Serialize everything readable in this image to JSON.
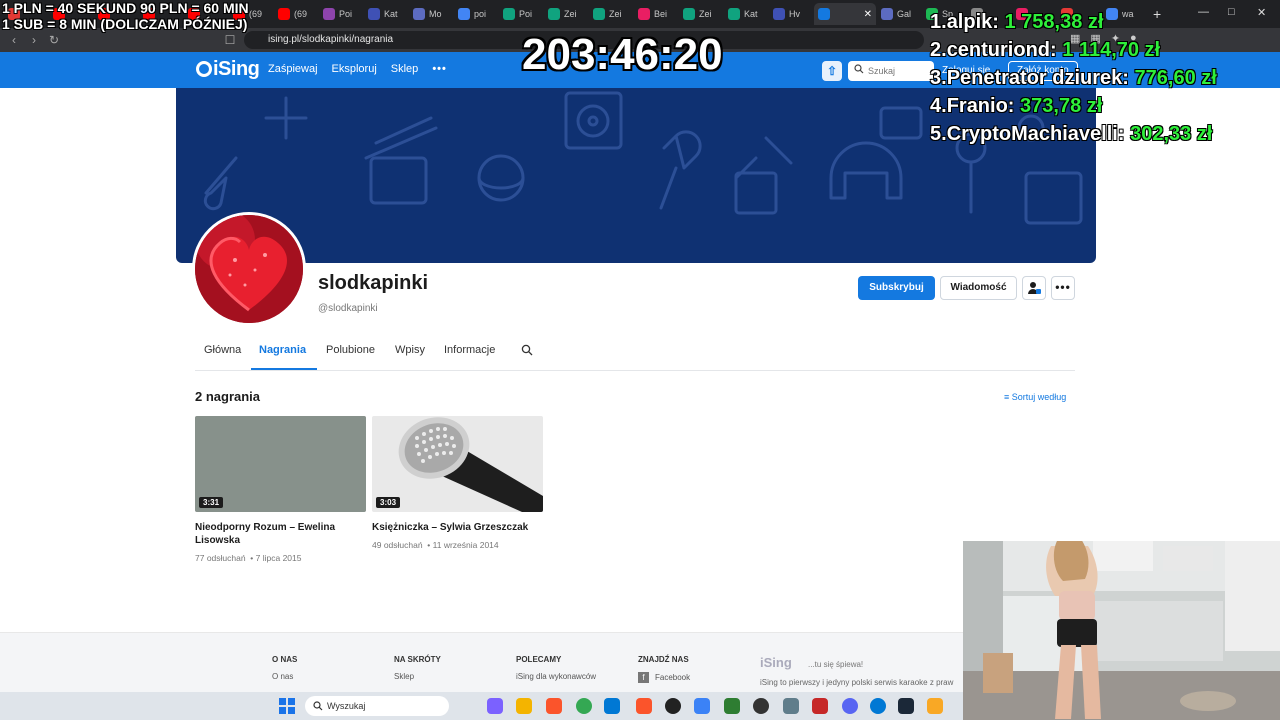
{
  "browser": {
    "tabs": [
      {
        "label": "",
        "color": "#e53935"
      },
      {
        "label": "",
        "color": "#ff0000"
      },
      {
        "label": "",
        "color": "#ff0000"
      },
      {
        "label": "",
        "color": "#ff0000"
      },
      {
        "label": "",
        "color": "#ff0000"
      },
      {
        "label": "(69",
        "color": "#ff0000"
      },
      {
        "label": "(69",
        "color": "#ff0000"
      },
      {
        "label": "Poi",
        "color": "#8e44ad"
      },
      {
        "label": "Kat",
        "color": "#3f51b5"
      },
      {
        "label": "Mo",
        "color": "#5c6bc0"
      },
      {
        "label": "poi",
        "color": "#4285f4"
      },
      {
        "label": "Poi",
        "color": "#10a37f"
      },
      {
        "label": "Zei",
        "color": "#10a37f"
      },
      {
        "label": "Zei",
        "color": "#10a37f"
      },
      {
        "label": "Bei",
        "color": "#e91e63"
      },
      {
        "label": "Zei",
        "color": "#10a37f"
      },
      {
        "label": "Kat",
        "color": "#10a37f"
      },
      {
        "label": "Hv",
        "color": "#3f51b5"
      },
      {
        "label": "",
        "color": "#1479e0",
        "active": true
      },
      {
        "label": "Gal",
        "color": "#5c6bc0"
      },
      {
        "label": "Sp",
        "color": "#1db954"
      },
      {
        "label": "",
        "color": "#888888"
      },
      {
        "label": "",
        "color": "#e91e63"
      },
      {
        "label": "",
        "color": "#e53935"
      },
      {
        "label": "wa",
        "color": "#4285f4"
      }
    ],
    "url": "ising.pl/slodkapinki/nagrania"
  },
  "header": {
    "logo": "iSing",
    "nav": [
      "Zaśpiewaj",
      "Eksploruj",
      "Sklep"
    ],
    "search_placeholder": "Szukaj",
    "login": "Zaloguj się",
    "register": "Załóż konto"
  },
  "profile": {
    "username": "slodkapinki",
    "handle": "@slodkapinki",
    "subscribe": "Subskrybuj",
    "message": "Wiadomość"
  },
  "tabs": [
    "Główna",
    "Nagrania",
    "Polubione",
    "Wpisy",
    "Informacje"
  ],
  "recordings": {
    "count_label": "2 nagrania",
    "sort_label": "Sortuj według",
    "items": [
      {
        "duration": "3:31",
        "title": "Nieodporny Rozum – Ewelina Lisowska",
        "plays": "77 odsłuchań",
        "date": "7 lipca 2015"
      },
      {
        "duration": "3:03",
        "title": "Księżniczka – Sylwia Grzeszczak",
        "plays": "49 odsłuchań",
        "date": "11 września 2014"
      }
    ]
  },
  "footer": {
    "columns": [
      {
        "heading": "O NAS",
        "link": "O nas"
      },
      {
        "heading": "NA SKRÓTY",
        "link": "Sklep"
      },
      {
        "heading": "POLECAMY",
        "link": "iSing dla wykonawców"
      },
      {
        "heading": "ZNAJDŹ NAS",
        "link": "Facebook"
      }
    ],
    "logo": "iSing",
    "tagline": "...tu się śpiewa!",
    "description": "iSing to pierwszy i jedyny polski serwis karaoke z praw"
  },
  "taskbar": {
    "search": "Wyszukaj"
  },
  "overlay": {
    "rule1": "1 PLN = 40 SEKUND 90 PLN = 60 MIN",
    "rule2": "1 SUB = 8 MIN (DOLICZAM PÓŹNIEJ)",
    "timer": "203:46:20",
    "leaderboard": [
      {
        "rank": "1.",
        "name": "alpik:",
        "amount": "1 758,38 zł"
      },
      {
        "rank": "2.",
        "name": "centuriond:",
        "amount": "1 114,70 zł"
      },
      {
        "rank": "3.",
        "name": "Penetrator dziurek:",
        "amount": "776,60 zł"
      },
      {
        "rank": "4.",
        "name": "Franio:",
        "amount": "373,78 zł"
      },
      {
        "rank": "5.",
        "name": "CryptoMachiavelli:",
        "amount": "302,33 zł"
      }
    ]
  },
  "colors": {
    "brand": "#1479e0",
    "banner": "#0f3172",
    "donation_green": "#2ef03a"
  }
}
